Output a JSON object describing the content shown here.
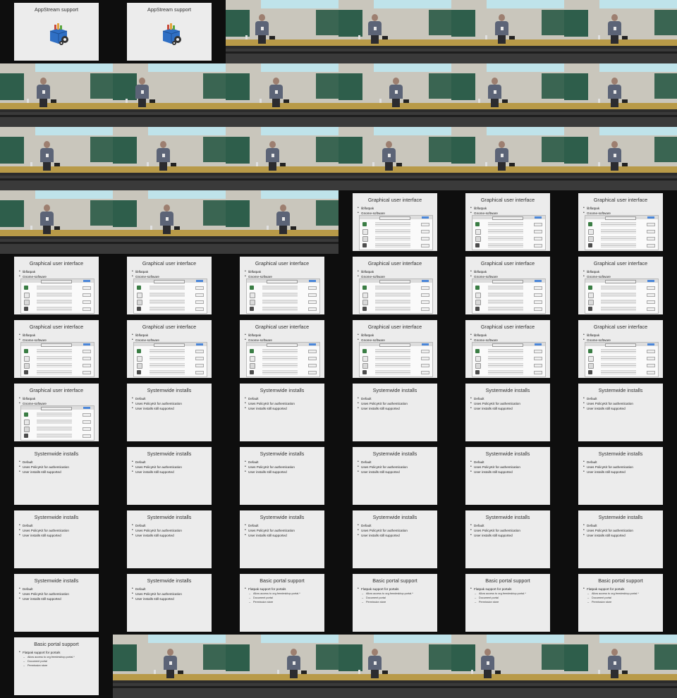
{
  "slides": {
    "appstream": {
      "title": "AppStream support",
      "bullets": []
    },
    "gui": {
      "title": "Graphical user interface",
      "bullets": [
        "libflatpak",
        "Gnome-software"
      ]
    },
    "systemwide": {
      "title": "Systemwide installs",
      "bullets": [
        "Default",
        "Uses PolicyKit for authentication",
        "User installs still supported"
      ]
    },
    "portal": {
      "title": "Basic portal support",
      "bullets": [
        "Flatpak support for portals"
      ],
      "sub_bullets": [
        "Allow access to org.freedesktop.portal.*",
        "Document portal",
        "Permission store"
      ]
    }
  },
  "frames": [
    "appstream",
    "appstream",
    "camera",
    "camera",
    "camera",
    "camera",
    "camera",
    "camera",
    "camera",
    "camera",
    "camera",
    "camera",
    "camera",
    "camera",
    "camera",
    "camera",
    "camera",
    "camera",
    "camera",
    "camera",
    "camera",
    "gui",
    "gui",
    "gui",
    "gui",
    "gui",
    "gui",
    "gui",
    "gui",
    "gui",
    "gui",
    "gui",
    "gui",
    "gui",
    "gui",
    "gui",
    "gui",
    "systemwide",
    "systemwide",
    "systemwide",
    "systemwide",
    "systemwide",
    "systemwide",
    "systemwide",
    "systemwide",
    "systemwide",
    "systemwide",
    "systemwide",
    "systemwide",
    "systemwide",
    "systemwide",
    "systemwide",
    "systemwide",
    "systemwide",
    "systemwide",
    "systemwide",
    "portal",
    "portal",
    "portal",
    "portal",
    "portal",
    "camera",
    "camera",
    "camera",
    "camera",
    "camera"
  ],
  "colors": {
    "background": "#0e0e0e",
    "slide_bg": "#ececec",
    "accent_blue": "#4a86d9"
  },
  "icons": {
    "appstream": "software-box-gears-icon"
  }
}
